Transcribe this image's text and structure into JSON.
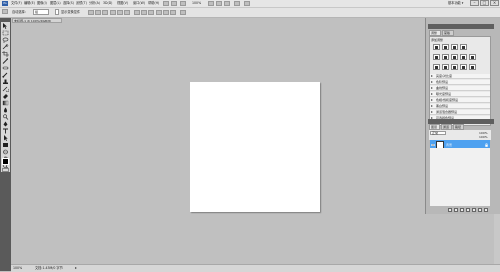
{
  "menubar": {
    "logo": "Ps",
    "menus": [
      "文件(F)",
      "编辑(E)",
      "图像(I)",
      "图层(L)",
      "选择(S)",
      "滤镜(T)",
      "分析(A)",
      "3D(D)",
      "视图(V)",
      "窗口(W)",
      "帮助(H)"
    ],
    "zoom": "100%",
    "workspace": "基本功能 ▾"
  },
  "options": {
    "tool_label": "自动选择:",
    "auto_select_value": "组",
    "show_transform": "显示变换控件"
  },
  "document": {
    "tab": "未标题-1 @ 100%(RGB/8)"
  },
  "status": {
    "zoom": "100%",
    "doc_info": "文档:1.43M/0 字节"
  },
  "panels": {
    "adjustments_tab": "调整",
    "masks_tab": "蒙版",
    "add_adjustment": "添加调整",
    "presets": [
      "亮度/对比度",
      "色阶预设",
      "曲线预设",
      "曝光度预设",
      "色相/饱和度预设",
      "黑白预设",
      "通道混合器预设",
      "可选颜色预设"
    ],
    "layers_tab": "图层",
    "channels_tab": "通道",
    "paths_tab": "路径",
    "blend_mode": "正常",
    "opacity": "100%",
    "fill": "100%",
    "layer_name": "背景"
  },
  "colors": {
    "ui_bg": "#c0c0c0",
    "selected_layer": "#4ea1f0",
    "tools_bg": "#5a5a5a"
  }
}
